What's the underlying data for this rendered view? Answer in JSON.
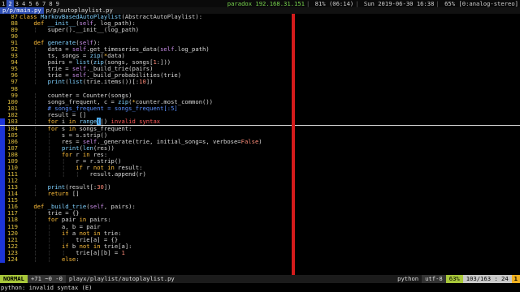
{
  "topbar": {
    "workspaces": [
      "1",
      "2",
      "3",
      "4",
      "5",
      "6",
      "7",
      "8",
      "9"
    ],
    "active_workspace": "2",
    "status_items": [
      "paradox 192.168.31.151",
      "81% (06:14)",
      "Sun 2019-06-30 16:38",
      "65%",
      "[0:analog-stereo]"
    ]
  },
  "tabline": {
    "active_tab": "p/p/main.py",
    "other_tab": "p/p/autoplaylist.py"
  },
  "editor": {
    "lines": [
      {
        "n": "87",
        "mark": false,
        "html": "<span class=\"kw\">class</span> <span class=\"fn\">MarkovBasedAutoPlaylist</span>(AbstractAutoPlaylist):"
      },
      {
        "n": "88",
        "mark": false,
        "html": "    <span class=\"kw\">def</span> <span class=\"fn\">__init__</span>(<span class=\"self\">self</span>, log_path):"
      },
      {
        "n": "89",
        "mark": false,
        "html": "    <span class=\"guide\">¦</span>   super().__init__(log_path)"
      },
      {
        "n": "90",
        "mark": false,
        "html": ""
      },
      {
        "n": "91",
        "mark": false,
        "html": "    <span class=\"kw\">def</span> <span class=\"fn\">generate</span>(<span class=\"self\">self</span>):"
      },
      {
        "n": "92",
        "mark": false,
        "html": "    <span class=\"guide\">¦</span>   data = <span class=\"self\">self</span>.get_timeseries_data(<span class=\"self\">self</span>.log_path)"
      },
      {
        "n": "93",
        "mark": false,
        "html": "    <span class=\"guide\">¦</span>   ts, songs = <span class=\"fn\">zip</span>(<span class=\"op\">*</span>data)"
      },
      {
        "n": "94",
        "mark": false,
        "html": "    <span class=\"guide\">¦</span>   pairs = <span class=\"fn\">list</span>(<span class=\"fn\">zip</span>(songs, songs[<span class=\"num\">1</span>:]))"
      },
      {
        "n": "95",
        "mark": false,
        "html": "    <span class=\"guide\">¦</span>   trie = <span class=\"self\">self</span>._build_trie(pairs)"
      },
      {
        "n": "96",
        "mark": false,
        "html": "    <span class=\"guide\">¦</span>   trie = <span class=\"self\">self</span>._build_probabilities(trie)"
      },
      {
        "n": "97",
        "mark": false,
        "html": "    <span class=\"guide\">¦</span>   <span class=\"fn\">print</span>(<span class=\"fn\">list</span>(trie.items())[:<span class=\"num\">10</span>])"
      },
      {
        "n": "98",
        "mark": false,
        "html": ""
      },
      {
        "n": "99",
        "mark": false,
        "html": "    <span class=\"guide\">¦</span>   counter = Counter(songs)"
      },
      {
        "n": "100",
        "mark": false,
        "html": "    <span class=\"guide\">¦</span>   songs_frequent, c = <span class=\"fn\">zip</span>(<span class=\"op\">*</span>counter.most_common())"
      },
      {
        "n": "101",
        "mark": false,
        "html": "    <span class=\"guide\">¦</span>   <span class=\"cmt\"># songs_frequent = songs_frequent[:5]</span>"
      },
      {
        "n": "102",
        "mark": false,
        "html": "    <span class=\"guide\">¦</span>   result = []"
      },
      {
        "n": "103",
        "mark": true,
        "cursorline": true,
        "html": "    <span class=\"guide\">¦</span>   <span class=\"kw\">for</span> i <span class=\"kw\">in</span> <span class=\"fn\">range</span><span class=\"cursor\">(</span>|) <span class=\"err\">invalid syntax</span>"
      },
      {
        "n": "104",
        "mark": true,
        "html": "    <span class=\"guide\">¦</span>   <span class=\"kw\">for</span> s <span class=\"kw\">in</span> songs_frequent:"
      },
      {
        "n": "105",
        "mark": true,
        "html": "    <span class=\"guide\">¦</span>   <span class=\"guide\">¦</span>   s = s.strip()"
      },
      {
        "n": "106",
        "mark": true,
        "html": "    <span class=\"guide\">¦</span>   <span class=\"guide\">¦</span>   res = <span class=\"self\">self</span>._generate(trie, initial_song=s, verbose=<span class=\"num\">False</span>)"
      },
      {
        "n": "107",
        "mark": true,
        "html": "    <span class=\"guide\">¦</span>   <span class=\"guide\">¦</span>   <span class=\"fn\">print</span>(<span class=\"fn\">len</span>(res))"
      },
      {
        "n": "108",
        "mark": true,
        "html": "    <span class=\"guide\">¦</span>   <span class=\"guide\">¦</span>   <span class=\"kw\">for</span> r <span class=\"kw\">in</span> res:"
      },
      {
        "n": "109",
        "mark": true,
        "html": "    <span class=\"guide\">¦</span>   <span class=\"guide\">¦</span>   <span class=\"guide\">¦</span>   r = r.strip()"
      },
      {
        "n": "110",
        "mark": true,
        "html": "    <span class=\"guide\">¦</span>   <span class=\"guide\">¦</span>   <span class=\"guide\">¦</span>   <span class=\"kw\">if</span> r <span class=\"kw\">not in</span> result:"
      },
      {
        "n": "111",
        "mark": true,
        "html": "    <span class=\"guide\">¦</span>   <span class=\"guide\">¦</span>   <span class=\"guide\">¦</span>   <span class=\"guide\">¦</span>   result.append(r)"
      },
      {
        "n": "112",
        "mark": true,
        "html": ""
      },
      {
        "n": "113",
        "mark": true,
        "html": "    <span class=\"guide\">¦</span>   <span class=\"fn\">print</span>(result[:<span class=\"num\">30</span>])"
      },
      {
        "n": "114",
        "mark": true,
        "html": "    <span class=\"guide\">¦</span>   <span class=\"kw\">return</span> []"
      },
      {
        "n": "115",
        "mark": true,
        "html": ""
      },
      {
        "n": "116",
        "mark": true,
        "html": "    <span class=\"kw\">def</span> <span class=\"fn\">_build_trie</span>(<span class=\"self\">self</span>, pairs):"
      },
      {
        "n": "117",
        "mark": true,
        "html": "    <span class=\"guide\">¦</span>   trie = {}"
      },
      {
        "n": "118",
        "mark": true,
        "html": "    <span class=\"guide\">¦</span>   <span class=\"kw\">for</span> pair <span class=\"kw\">in</span> pairs:"
      },
      {
        "n": "119",
        "mark": true,
        "html": "    <span class=\"guide\">¦</span>   <span class=\"guide\">¦</span>   a, b = pair"
      },
      {
        "n": "120",
        "mark": true,
        "html": "    <span class=\"guide\">¦</span>   <span class=\"guide\">¦</span>   <span class=\"kw\">if</span> a <span class=\"kw\">not in</span> trie:"
      },
      {
        "n": "121",
        "mark": true,
        "html": "    <span class=\"guide\">¦</span>   <span class=\"guide\">¦</span>   <span class=\"guide\">¦</span>   trie[a] = {}"
      },
      {
        "n": "122",
        "mark": true,
        "html": "    <span class=\"guide\">¦</span>   <span class=\"guide\">¦</span>   <span class=\"kw\">if</span> b <span class=\"kw\">not in</span> trie[a]:"
      },
      {
        "n": "123",
        "mark": true,
        "html": "    <span class=\"guide\">¦</span>   <span class=\"guide\">¦</span>   <span class=\"guide\">¦</span>   trie[a][b] = <span class=\"num\">1</span>"
      },
      {
        "n": "124",
        "mark": true,
        "html": "    <span class=\"guide\">¦</span>   <span class=\"guide\">¦</span>   <span class=\"kw\">else</span>:"
      }
    ]
  },
  "statusline": {
    "mode": "NORMAL",
    "diff": "+71 ~0 -0",
    "file": "playx/playlist/autoplaylist.py",
    "filetype": "python",
    "encoding": "utf-8",
    "percent": "63%",
    "position": "103/163",
    "column": "24",
    "warning": "1"
  },
  "cmdline": {
    "text": "python: invalid syntax (E)"
  },
  "colors": {
    "accent_blue": "#2f4fb5",
    "ruler_red": "#d21b1b",
    "mode_green": "#a8c73a"
  }
}
